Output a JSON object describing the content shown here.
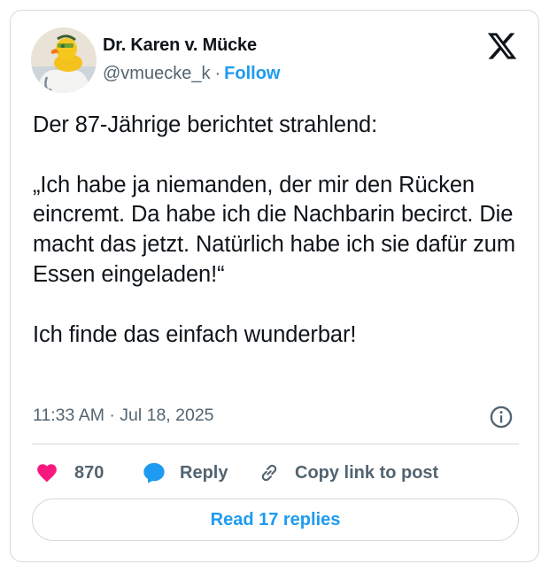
{
  "author": {
    "name": "Dr. Karen v. Mücke",
    "handle": "@vmuecke_k",
    "separator": "·",
    "follow_label": "Follow"
  },
  "tweet": {
    "text": "Der 87-Jährige berichtet strahlend:\n\n„Ich habe ja niemanden, der mir den Rücken eincremt. Da habe ich die Nachbarin becirct. Die macht das jetzt. Natürlich habe ich sie dafür zum Essen eingeladen!“\n\nIch finde das einfach wunderbar!",
    "timestamp": "11:33 AM · Jul 18, 2025"
  },
  "actions": {
    "like_count": "870",
    "reply_label": "Reply",
    "copy_label": "Copy link to post"
  },
  "read_replies_label": "Read 17 replies",
  "icons": {
    "logo": "x-logo-icon",
    "info": "info-icon",
    "like": "heart-icon",
    "reply": "speech-bubble-icon",
    "copy": "link-icon"
  },
  "colors": {
    "accent": "#1d9bf0",
    "like": "#f91880",
    "reply": "#1d9bf0",
    "muted": "#536471",
    "border": "#cfd9de",
    "text": "#0f1419"
  }
}
